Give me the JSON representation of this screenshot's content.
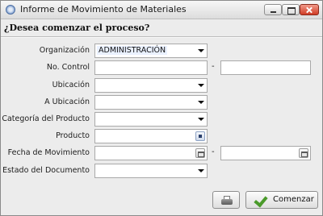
{
  "window": {
    "title": "Informe de Movimiento de Materiales",
    "controls": [
      "minimize-icon",
      "maximize-icon",
      "close-icon"
    ]
  },
  "prompt": "¿Desea comenzar el proceso?",
  "form": {
    "organizacion": {
      "label": "Organización",
      "value": "ADMINISTRACIÓN"
    },
    "no_control": {
      "label": "No. Control",
      "value_from": "",
      "value_to": "",
      "separator": "-"
    },
    "ubicacion": {
      "label": "Ubicación",
      "value": ""
    },
    "a_ubicacion": {
      "label": "A Ubicación",
      "value": ""
    },
    "categoria": {
      "label": "Categoría del Producto",
      "value": ""
    },
    "producto": {
      "label": "Producto",
      "value": ""
    },
    "fecha": {
      "label": "Fecha de Movimiento",
      "value_from": "",
      "value_to": "",
      "separator": "-"
    },
    "estado": {
      "label": "Estado del Documento",
      "value": ""
    }
  },
  "buttons": {
    "print_icon": "printer-icon",
    "ok_icon": "checkmark-icon",
    "ok_label": "Comenzar"
  },
  "colors": {
    "ok_check": "#4a9a2a",
    "close_button": "#cf3b25"
  }
}
